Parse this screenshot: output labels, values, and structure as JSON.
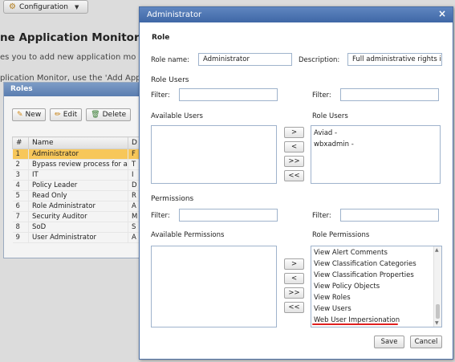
{
  "background": {
    "config_button": {
      "label": "Configuration"
    },
    "heading": "ne Application Monitors So",
    "line1": "es you to add new application mo",
    "line2": "plication Monitor, use the 'Add App"
  },
  "roles_panel": {
    "title": "Roles",
    "toolbar": {
      "new": "New",
      "edit": "Edit",
      "delete": "Delete"
    },
    "columns": [
      "#",
      "Name",
      "D"
    ],
    "rows": [
      {
        "num": "1",
        "name": "Administrator",
        "desc": "F"
      },
      {
        "num": "2",
        "name": "Bypass review process for a",
        "desc": "T"
      },
      {
        "num": "3",
        "name": "IT",
        "desc": "I"
      },
      {
        "num": "4",
        "name": "Policy Leader",
        "desc": "D"
      },
      {
        "num": "5",
        "name": "Read Only",
        "desc": "R"
      },
      {
        "num": "6",
        "name": "Role Administrator",
        "desc": "A"
      },
      {
        "num": "7",
        "name": "Security Auditor",
        "desc": "M"
      },
      {
        "num": "8",
        "name": "SoD",
        "desc": "S"
      },
      {
        "num": "9",
        "name": "User Administrator",
        "desc": "A"
      }
    ]
  },
  "dialog": {
    "title": "Administrator",
    "close": "×",
    "role_section": "Role",
    "role_name_label": "Role name:",
    "role_name_value": "Administrator",
    "description_label": "Description:",
    "description_value": "Full administrative rights i",
    "role_users_section": "Role Users",
    "filter_label": "Filter:",
    "available_users_label": "Available Users",
    "role_users_label": "Role Users",
    "role_users": [
      "Aviad -",
      "wbxadmin -"
    ],
    "move_buttons": [
      ">",
      "<",
      ">>",
      "<<"
    ],
    "permissions_section": "Permissions",
    "available_permissions_label": "Available Permissions",
    "role_permissions_label": "Role Permissions",
    "role_permissions": [
      "View Alert Comments",
      "View Classification Categories",
      "View Classification Properties",
      "View Policy Objects",
      "View Roles",
      "View Users",
      "Web User Impersionation"
    ],
    "save": "Save",
    "cancel": "Cancel",
    "accent_color": "#4a6ea4",
    "highlight_color": "#f7c75a",
    "underline_color": "#e02020"
  }
}
